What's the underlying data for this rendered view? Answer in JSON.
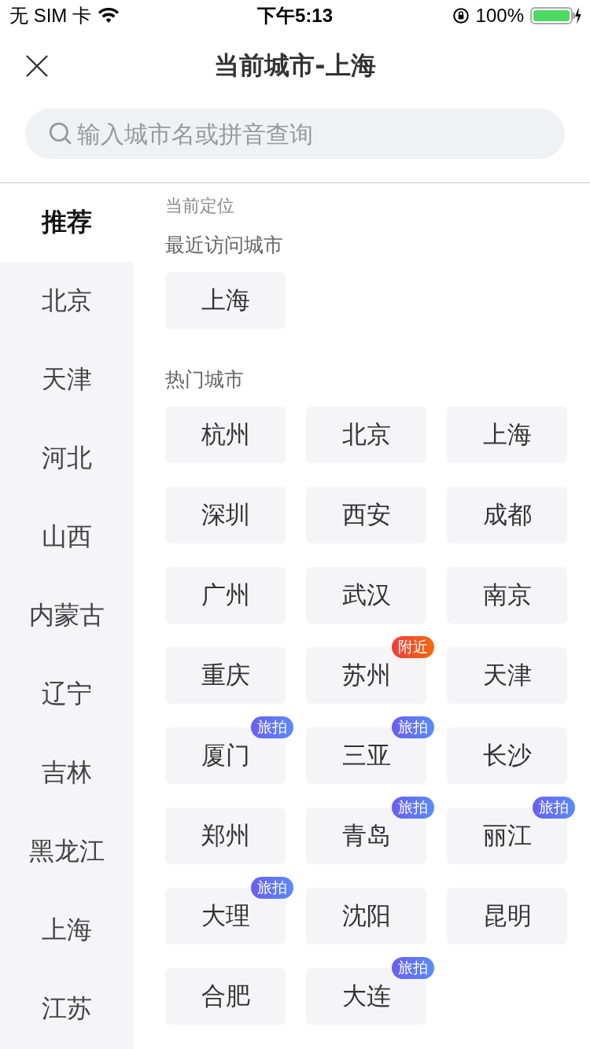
{
  "status_bar": {
    "carrier": "无 SIM 卡",
    "time": "下午5:13",
    "battery": "100%"
  },
  "header": {
    "title": "当前城市-上海"
  },
  "search": {
    "placeholder": "输入城市名或拼音查询"
  },
  "sidebar": {
    "items": [
      {
        "label": "推荐",
        "selected": true
      },
      {
        "label": "北京",
        "selected": false
      },
      {
        "label": "天津",
        "selected": false
      },
      {
        "label": "河北",
        "selected": false
      },
      {
        "label": "山西",
        "selected": false
      },
      {
        "label": "内蒙古",
        "selected": false
      },
      {
        "label": "辽宁",
        "selected": false
      },
      {
        "label": "吉林",
        "selected": false
      },
      {
        "label": "黑龙江",
        "selected": false
      },
      {
        "label": "上海",
        "selected": false
      },
      {
        "label": "江苏",
        "selected": false
      }
    ]
  },
  "sections": [
    {
      "title": "当前定位"
    },
    {
      "title": "最近访问城市",
      "cities": [
        {
          "name": "上海"
        }
      ]
    },
    {
      "title": "热门城市",
      "cities": [
        {
          "name": "杭州"
        },
        {
          "name": "北京"
        },
        {
          "name": "上海"
        },
        {
          "name": "深圳"
        },
        {
          "name": "西安"
        },
        {
          "name": "成都"
        },
        {
          "name": "广州"
        },
        {
          "name": "武汉"
        },
        {
          "name": "南京"
        },
        {
          "name": "重庆"
        },
        {
          "name": "苏州",
          "tag": {
            "kind": "nearby",
            "text": "附近"
          }
        },
        {
          "name": "天津"
        },
        {
          "name": "厦门",
          "tag": {
            "kind": "travel",
            "text": "旅拍"
          }
        },
        {
          "name": "三亚",
          "tag": {
            "kind": "travel",
            "text": "旅拍"
          }
        },
        {
          "name": "长沙"
        },
        {
          "name": "郑州"
        },
        {
          "name": "青岛",
          "tag": {
            "kind": "travel",
            "text": "旅拍"
          }
        },
        {
          "name": "丽江",
          "tag": {
            "kind": "travel",
            "text": "旅拍"
          }
        },
        {
          "name": "大理",
          "tag": {
            "kind": "travel",
            "text": "旅拍"
          }
        },
        {
          "name": "沈阳"
        },
        {
          "name": "昆明"
        },
        {
          "name": "合肥"
        },
        {
          "name": "大连",
          "tag": {
            "kind": "travel",
            "text": "旅拍"
          }
        }
      ]
    }
  ]
}
